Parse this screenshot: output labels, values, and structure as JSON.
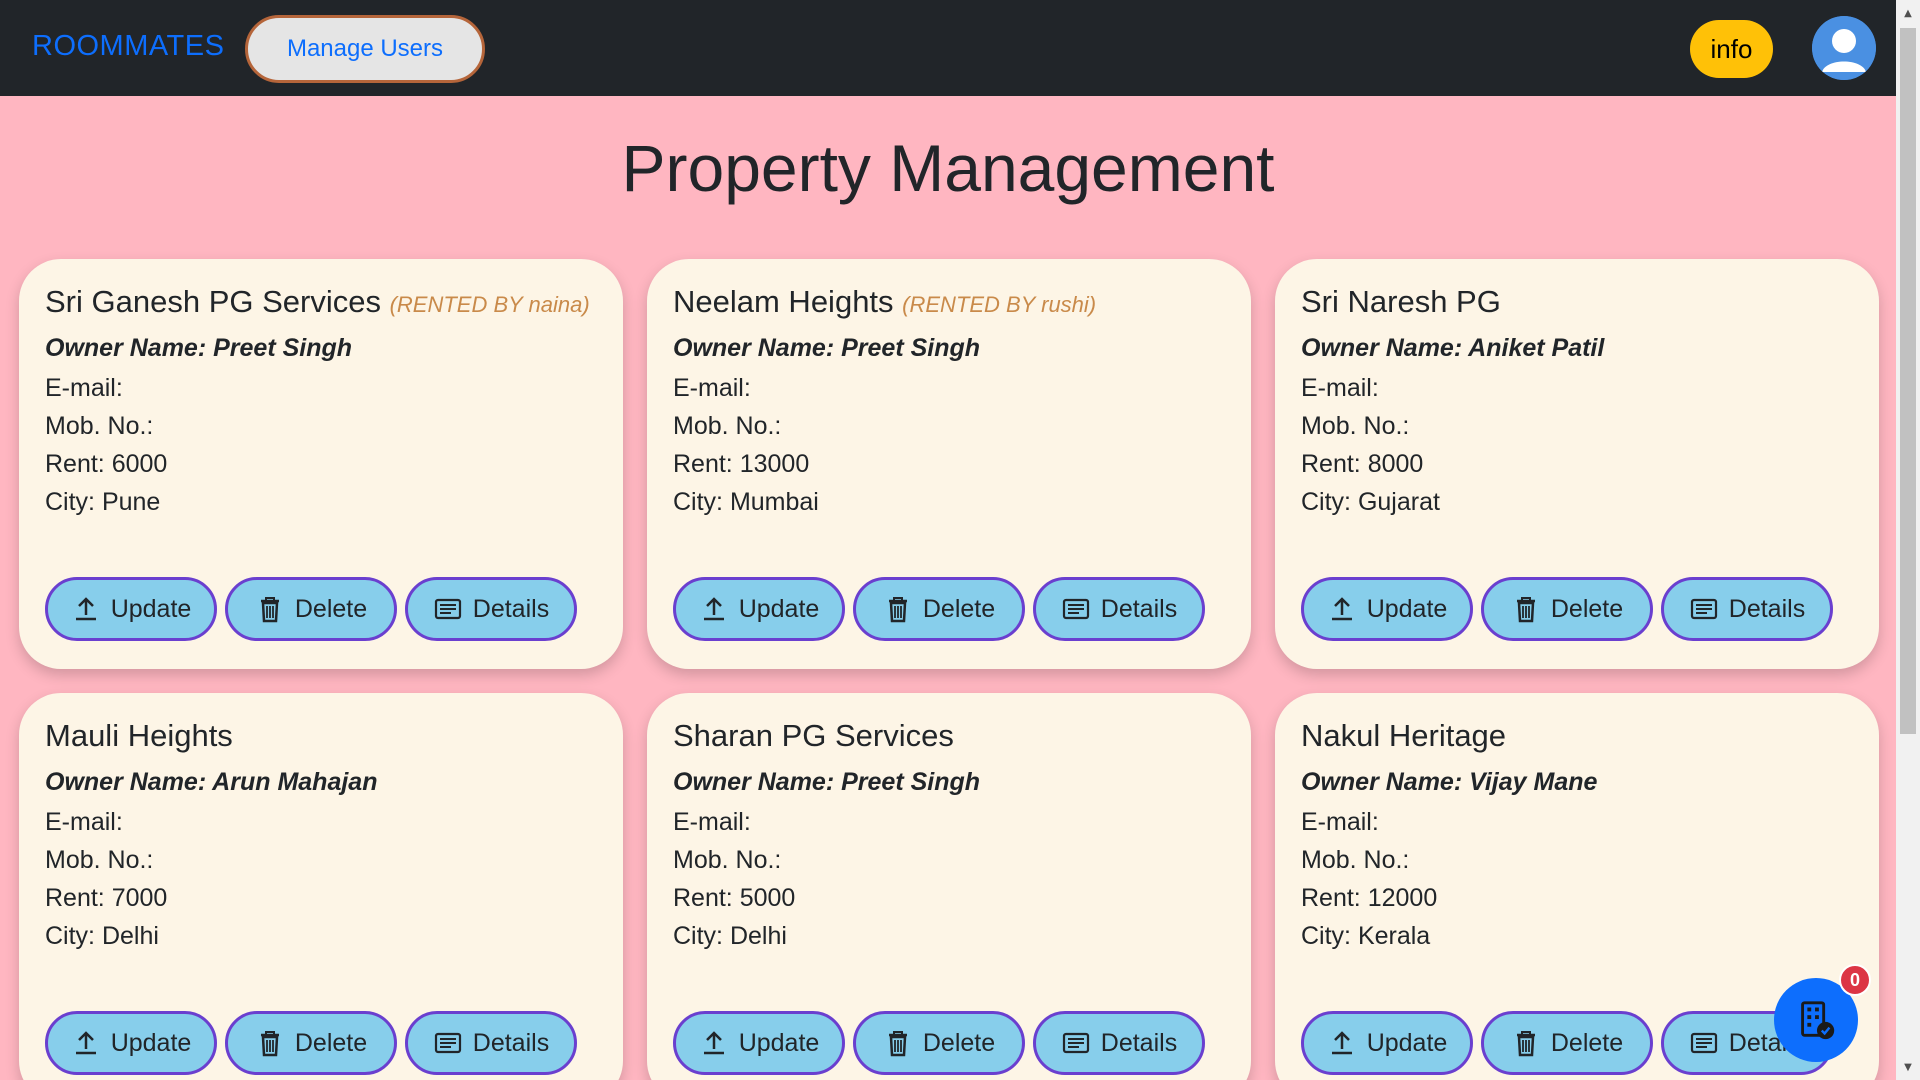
{
  "nav": {
    "brand": "ROOMMATES",
    "manage_users": "Manage Users",
    "info": "info"
  },
  "page_title": "Property Management",
  "labels": {
    "email": "E-mail:",
    "mobile": "Mob. No.:",
    "update": "Update",
    "delete": "Delete",
    "details": "Details"
  },
  "cards": [
    {
      "name": "Sri Ganesh PG Services",
      "rented": "(RENTED BY naina)",
      "owner": "Owner Name: Preet Singh",
      "email": "E-mail:",
      "mobile": "Mob. No.:",
      "rent": "Rent: 6000",
      "city": "City: Pune"
    },
    {
      "name": "Neelam Heights",
      "rented": "(RENTED BY rushi)",
      "owner": "Owner Name: Preet Singh",
      "email": "E-mail:",
      "mobile": "Mob. No.:",
      "rent": "Rent: 13000",
      "city": "City: Mumbai"
    },
    {
      "name": "Sri Naresh PG",
      "rented": "",
      "owner": "Owner Name: Aniket Patil",
      "email": "E-mail:",
      "mobile": "Mob. No.:",
      "rent": "Rent: 8000",
      "city": "City: Gujarat"
    },
    {
      "name": "Mauli Heights",
      "rented": "",
      "owner": "Owner Name: Arun Mahajan",
      "email": "E-mail:",
      "mobile": "Mob. No.:",
      "rent": "Rent: 7000",
      "city": "City: Delhi"
    },
    {
      "name": "Sharan PG Services",
      "rented": "",
      "owner": "Owner Name: Preet Singh",
      "email": "E-mail:",
      "mobile": "Mob. No.:",
      "rent": "Rent: 5000",
      "city": "City: Delhi"
    },
    {
      "name": "Nakul Heritage",
      "rented": "",
      "owner": "Owner Name: Vijay Mane",
      "email": "E-mail:",
      "mobile": "Mob. No.:",
      "rent": "Rent: 12000",
      "city": "City: Kerala"
    }
  ],
  "fab": {
    "badge": "0",
    "icon": "building-check-icon"
  },
  "colors": {
    "background": "#ffb6c1",
    "navbar": "#212529",
    "brand": "#0d6efd",
    "info": "#ffc107",
    "card": "#fdf5e6",
    "button": "#87ceeb",
    "button_border": "#6a3fcf",
    "rented_text": "#c98a4a",
    "badge": "#dc3545"
  }
}
